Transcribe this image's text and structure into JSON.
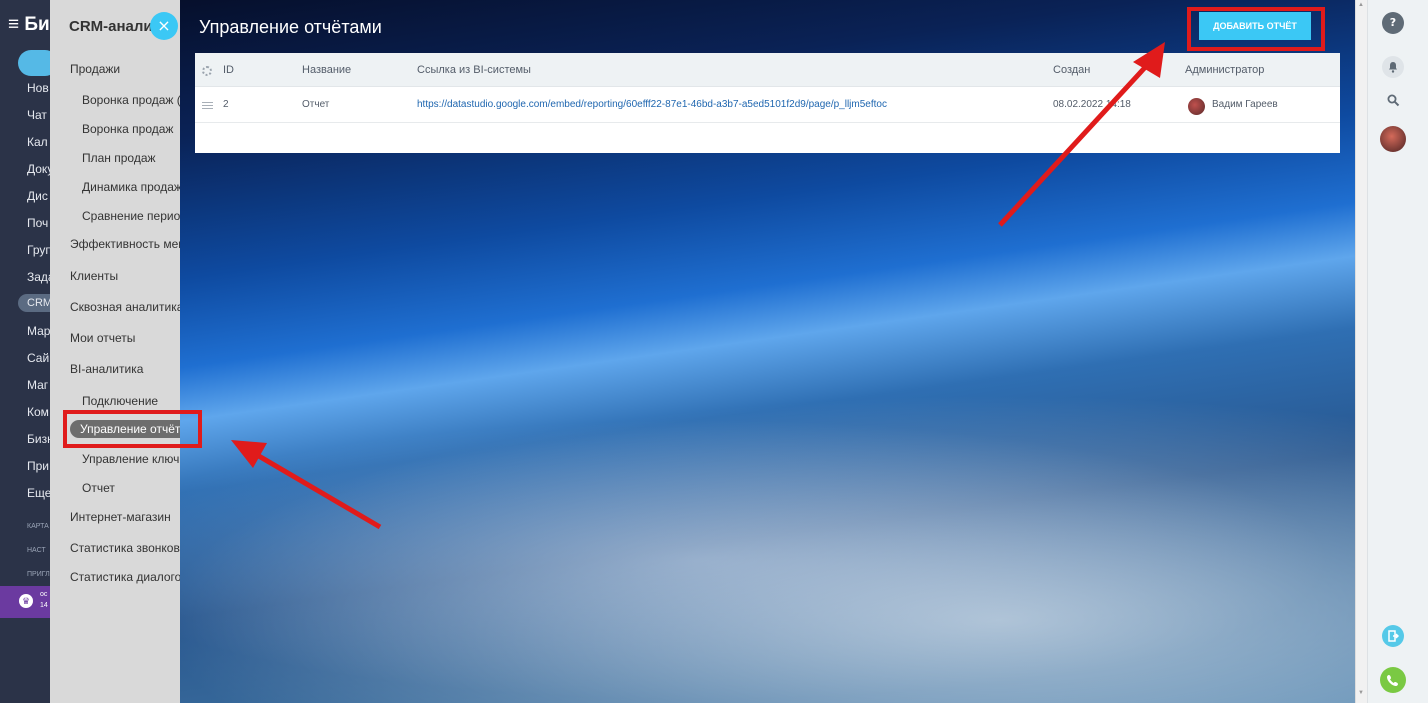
{
  "leftnav": {
    "logo": "≡ Би",
    "items": [
      "Нов",
      "Чат",
      "Кал",
      "Доку",
      "Дис",
      "Поч",
      "Груп",
      "Зада",
      "CRM",
      "Мар",
      "Сай",
      "Маг",
      "Ком",
      "Бизн",
      "При",
      "Еще"
    ],
    "small": [
      "КАРТА",
      "НАСТ",
      "ПРИГЛ"
    ],
    "promo_line1": "ос",
    "promo_line2": "14"
  },
  "submenu": {
    "title": "CRM-анали",
    "close_glyph": "×",
    "items": [
      {
        "label": "Продажи",
        "level": 1
      },
      {
        "label": "Воронка продаж (",
        "level": 2
      },
      {
        "label": "Воронка продаж",
        "level": 2
      },
      {
        "label": "План продаж",
        "level": 2
      },
      {
        "label": "Динамика продаж",
        "level": 2
      },
      {
        "label": "Сравнение перио",
        "level": 2
      },
      {
        "label": "Эффективность мен",
        "level": 1
      },
      {
        "label": "Клиенты",
        "level": 1
      },
      {
        "label": "Сквозная аналитика",
        "level": 1
      },
      {
        "label": "Мои отчеты",
        "level": 1
      },
      {
        "label": "BI-аналитика",
        "level": 1
      },
      {
        "label": "Подключение",
        "level": 2
      },
      {
        "label": "Управление отчёт",
        "level": 2,
        "active": true
      },
      {
        "label": "Управление ключ",
        "level": 2
      },
      {
        "label": "Отчет",
        "level": 2
      },
      {
        "label": "Интернет-магазин",
        "level": 1
      },
      {
        "label": "Статистика звонков",
        "level": 1
      },
      {
        "label": "Статистика диалогов",
        "level": 1
      }
    ]
  },
  "page": {
    "title": "Управление отчётами",
    "add_button": "ДОБАВИТЬ ОТЧЁТ"
  },
  "table": {
    "columns": [
      "ID",
      "Название",
      "Ссылка из BI-системы",
      "Создан",
      "Администратор"
    ],
    "rows": [
      {
        "id": "2",
        "name": "Отчет",
        "link": "https://datastudio.google.com/embed/reporting/60efff22-87e1-46bd-a3b7-a5ed5101f2d9/page/p_lljm5eftoc",
        "created": "08.02.2022 14:18",
        "admin": "Вадим Гареев"
      }
    ]
  },
  "right_sidebar": {
    "icons": [
      "help-icon",
      "bell-icon",
      "search-icon",
      "user-avatar",
      "exit-icon",
      "phone-icon"
    ]
  },
  "annotation_color": "#e01b1b",
  "accent_color": "#3bc8f5"
}
